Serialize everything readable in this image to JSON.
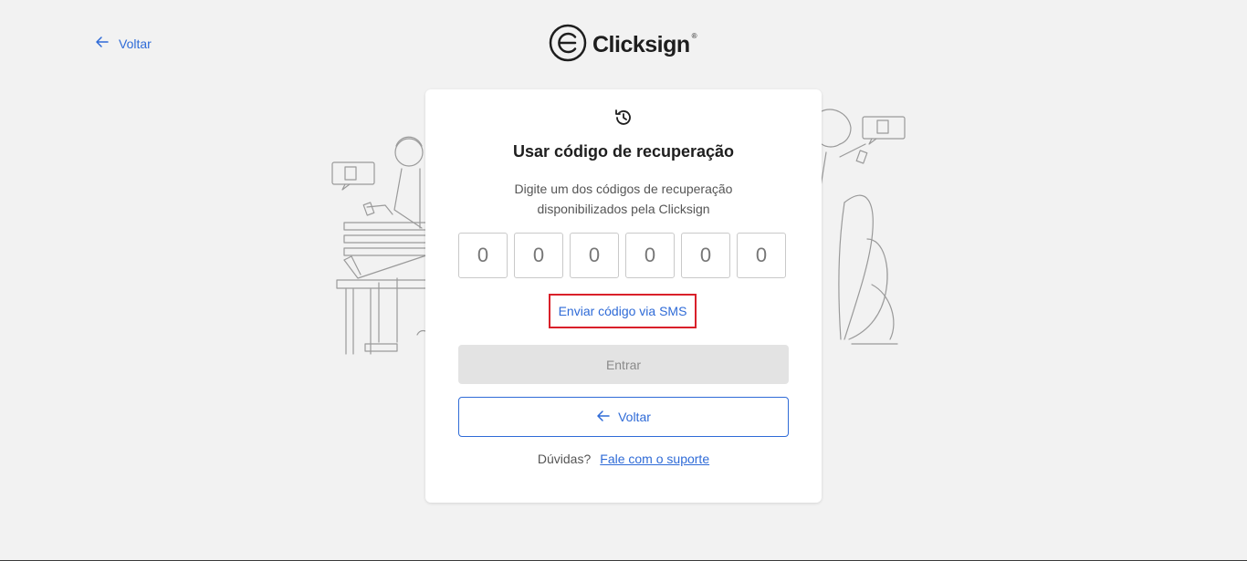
{
  "header": {
    "back_label": "Voltar",
    "logo_text": "Clicksign",
    "logo_reg": "®"
  },
  "card": {
    "title": "Usar código de recuperação",
    "subtitle": "Digite um dos códigos de recuperação disponibilizados pela Clicksign",
    "code_placeholders": [
      "0",
      "0",
      "0",
      "0",
      "0",
      "0"
    ],
    "sms_link": "Enviar código via SMS",
    "enter_button": "Entrar",
    "back_button": "Voltar",
    "help_question": "Dúvidas?",
    "help_link": "Fale com o suporte"
  },
  "colors": {
    "accent": "#2f6bd7",
    "highlight_border": "#d9202a",
    "background": "#f2f2f2"
  },
  "icons": {
    "back": "arrow-left-icon",
    "history": "history-icon",
    "logo": "clicksign-logo-icon"
  }
}
